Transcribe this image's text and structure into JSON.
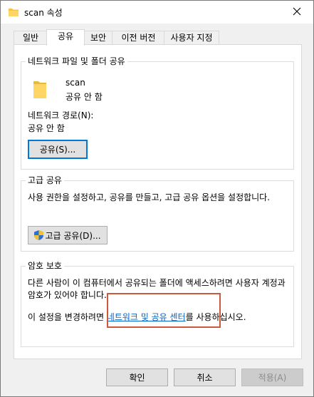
{
  "window": {
    "title": "scan 속성",
    "folder_icon": "folder-icon",
    "close_icon": "close-icon"
  },
  "tabs": [
    {
      "label": "일반"
    },
    {
      "label": "공유",
      "active": true
    },
    {
      "label": "보안"
    },
    {
      "label": "이전 버전"
    },
    {
      "label": "사용자 지정"
    }
  ],
  "network_share": {
    "group_label": "네트워크 파일 및 폴더 공유",
    "folder_name": "scan",
    "folder_status": "공유 안 함",
    "path_label": "네트워크 경로(N):",
    "path_value": "공유 안 함",
    "share_button": "공유(S)..."
  },
  "advanced_share": {
    "group_label": "고급 공유",
    "description": "사용 권한을 설정하고, 공유를 만들고, 고급 공유 옵션을 설정합니다.",
    "button": "고급 공유(D)..."
  },
  "password_protection": {
    "group_label": "암호 보호",
    "description": "다른 사람이 이 컴퓨터에서 공유되는 폴더에 액세스하려면 사용자 계정과 암호가 있어야 합니다.",
    "change_prefix": "이 설정을 변경하려면 ",
    "link_text": "네트워크 및 공유 센터",
    "change_suffix": "를 사용하십시오."
  },
  "footer": {
    "ok": "확인",
    "cancel": "취소",
    "apply": "적용(A)"
  },
  "colors": {
    "accent": "#0078d7",
    "link": "#0066cc",
    "highlight": "#d0583a",
    "folder": "#f5c542"
  }
}
